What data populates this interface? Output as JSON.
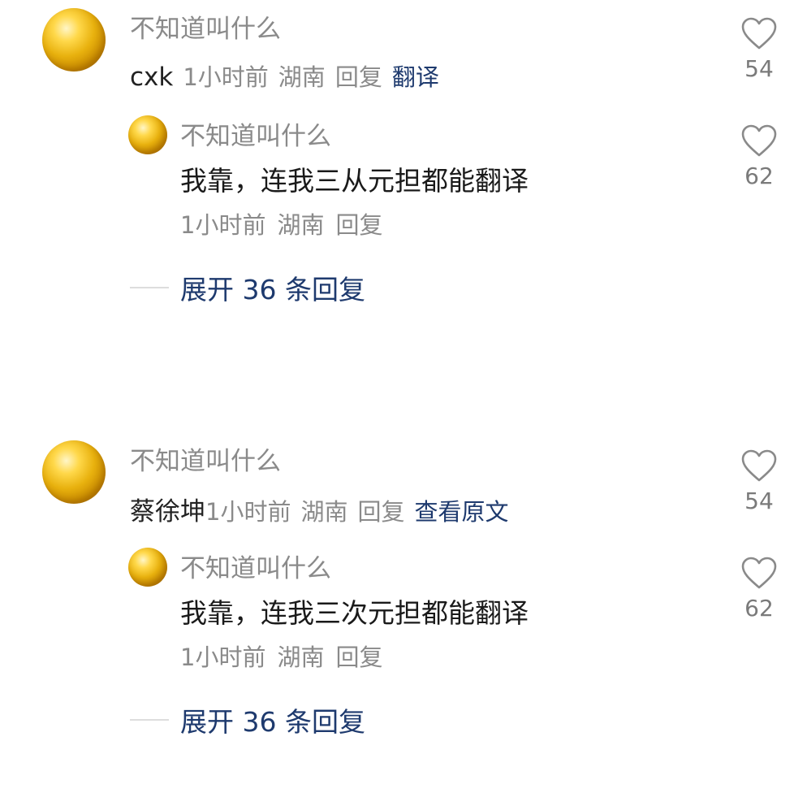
{
  "threads": [
    {
      "comment": {
        "username": "不知道叫什么",
        "text": "cxk",
        "time": "1小时前",
        "location": "湖南",
        "reply_label": "回复",
        "action_label": "翻译",
        "likes": "54"
      },
      "reply": {
        "username": "不知道叫什么",
        "text": "我靠，连我三从元担都能翻译",
        "time": "1小时前",
        "location": "湖南",
        "reply_label": "回复",
        "likes": "62"
      },
      "expand_label": "展开 36 条回复"
    },
    {
      "comment": {
        "username": "不知道叫什么",
        "text": "蔡徐坤",
        "time": "1小时前",
        "location": "湖南",
        "reply_label": "回复",
        "action_label": "查看原文",
        "likes": "54"
      },
      "reply": {
        "username": "不知道叫什么",
        "text": "我靠，连我三次元担都能翻译",
        "time": "1小时前",
        "location": "湖南",
        "reply_label": "回复",
        "likes": "62"
      },
      "expand_label": "展开 36 条回复"
    }
  ],
  "icons": {
    "avatar": "gold-sphere-avatar",
    "like": "heart-outline-icon"
  },
  "colors": {
    "link": "#1e3a6e",
    "meta": "#8a8a8a",
    "text": "#1a1a1a"
  }
}
